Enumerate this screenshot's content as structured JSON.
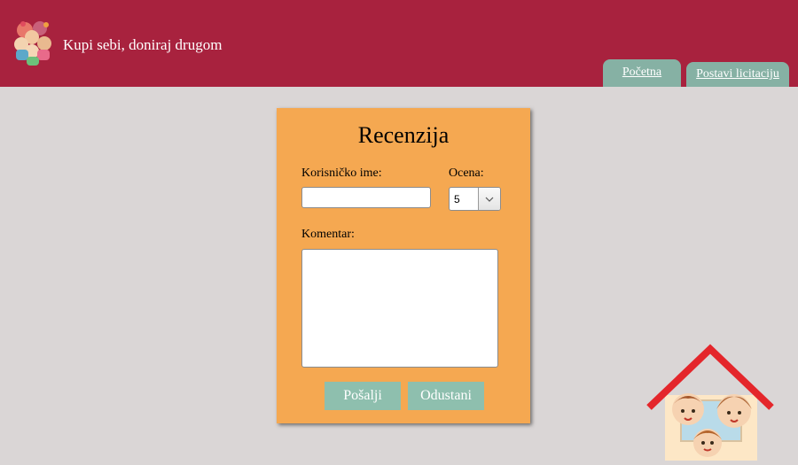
{
  "header": {
    "site_title": "Kupi sebi, doniraj drugom",
    "logo_icon": "children-group-icon",
    "tabs": [
      {
        "label": "Početna"
      },
      {
        "label": "Postavi licitaciju"
      }
    ],
    "colors": {
      "background": "#a8223e",
      "tab": "#86b1a4"
    }
  },
  "form": {
    "title": "Recenzija",
    "username_label": "Korisničko ime:",
    "username_value": "",
    "rating_label": "Ocena:",
    "rating_selected": "5",
    "comment_label": "Komentar:",
    "comment_value": "",
    "submit_label": "Pošalji",
    "cancel_label": "Odustani",
    "colors": {
      "card": "#f5a851",
      "button": "#8ebfae"
    }
  },
  "decoration": {
    "house_icon": "family-house-icon"
  },
  "page": {
    "background": "#dad6d6"
  }
}
